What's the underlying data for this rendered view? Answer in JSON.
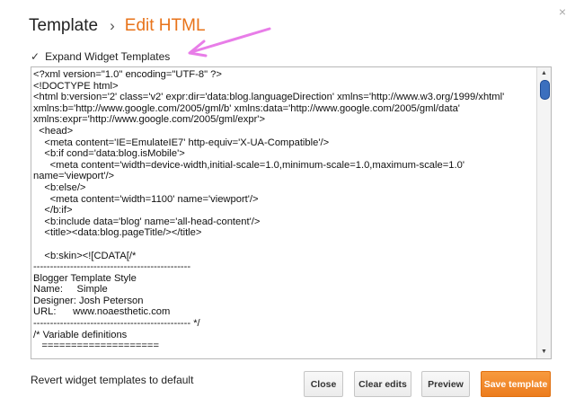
{
  "dialog": {
    "close_glyph": "×",
    "breadcrumb": {
      "parent": "Template",
      "separator": "›",
      "current": "Edit HTML"
    },
    "expand_widget_templates": {
      "checked": true,
      "label": "Expand Widget Templates"
    },
    "code_lines": [
      "<?xml version=\"1.0\" encoding=\"UTF-8\" ?>",
      "<!DOCTYPE html>",
      "<html b:version='2' class='v2' expr:dir='data:blog.languageDirection' xmlns='http://www.w3.org/1999/xhtml'",
      "xmlns:b='http://www.google.com/2005/gml/b' xmlns:data='http://www.google.com/2005/gml/data'",
      "xmlns:expr='http://www.google.com/2005/gml/expr'>",
      "  <head>",
      "    <meta content='IE=EmulateIE7' http-equiv='X-UA-Compatible'/>",
      "    <b:if cond='data:blog.isMobile'>",
      "      <meta content='width=device-width,initial-scale=1.0,minimum-scale=1.0,maximum-scale=1.0'",
      "name='viewport'/>",
      "    <b:else/>",
      "      <meta content='width=1100' name='viewport'/>",
      "    </b:if>",
      "    <b:include data='blog' name='all-head-content'/>",
      "    <title><data:blog.pageTitle/></title>",
      "",
      "    <b:skin><![CDATA[/*",
      "-----------------------------------------------",
      "Blogger Template Style",
      "Name:     Simple",
      "Designer: Josh Peterson",
      "URL:      www.noaesthetic.com",
      "----------------------------------------------- */",
      "/* Variable definitions",
      "   ===================="
    ],
    "revert_link": "Revert widget templates to default",
    "buttons": {
      "close": "Close",
      "clear_edits": "Clear edits",
      "preview": "Preview",
      "save_template": "Save template"
    },
    "colors": {
      "accent_orange": "#e8731a",
      "annotation_arrow": "#e87de8",
      "scroll_thumb": "#3b6fbe"
    }
  }
}
